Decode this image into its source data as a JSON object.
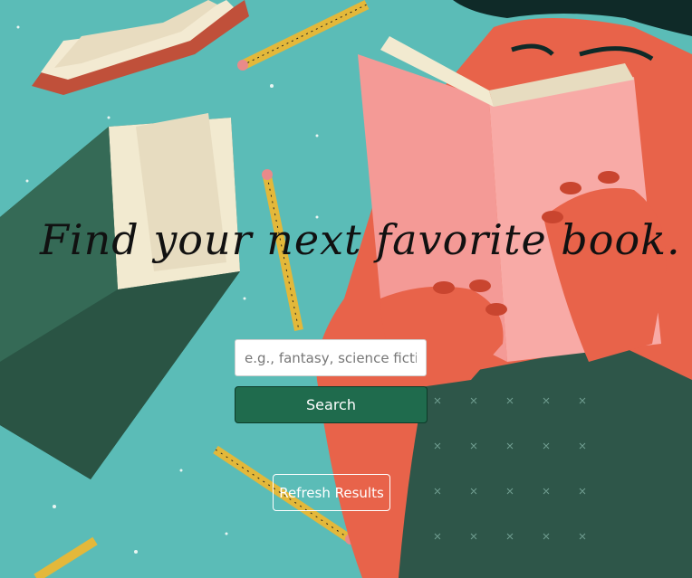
{
  "hero": {
    "headline": "Find your next favorite book."
  },
  "search": {
    "placeholder": "e.g., fantasy, science fiction",
    "button_label": "Search"
  },
  "refresh": {
    "button_label": "Refresh Results"
  },
  "colors": {
    "background": "#5bbcb7",
    "search_button": "#1f6b4d",
    "book_pink": "#f49a96",
    "skin": "#e8634a",
    "dark_green_book": "#2f5d4c"
  }
}
